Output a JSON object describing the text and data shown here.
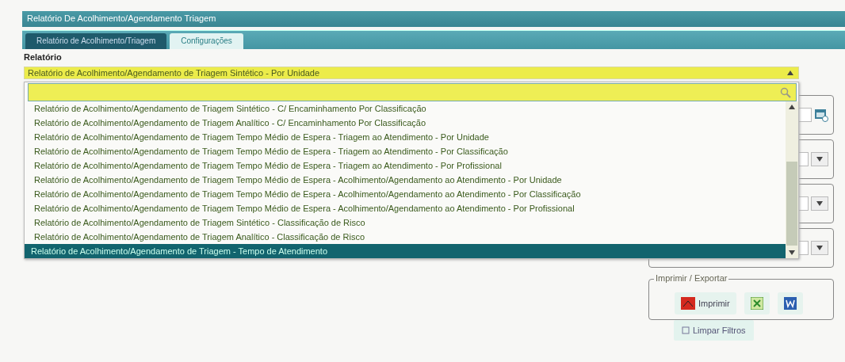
{
  "window": {
    "title": "Relatório De Acolhimento/Agendamento Triagem"
  },
  "tabs": [
    {
      "label": "Relatório de Acolhimento/Triagem",
      "selected": true
    },
    {
      "label": "Configurações",
      "selected": false
    }
  ],
  "report_field": {
    "label": "Relatório",
    "value": "Relatório de Acolhimento/Agendamento de Triagem Sintético - Por Unidade",
    "expanded": true
  },
  "options": [
    {
      "label": "Relatório de Acolhimento/Agendamento de Triagem Sintético - C/ Encaminhamento Por Classificação",
      "selected": false
    },
    {
      "label": "Relatório de Acolhimento/Agendamento de Triagem Analítico - C/ Encaminhamento Por Classificação",
      "selected": false
    },
    {
      "label": "Relatório de Acolhimento/Agendamento de Triagem Tempo Médio de Espera - Triagem ao Atendimento - Por Unidade",
      "selected": false
    },
    {
      "label": "Relatório de Acolhimento/Agendamento de Triagem Tempo Médio de Espera - Triagem ao Atendimento - Por Classificação",
      "selected": false
    },
    {
      "label": "Relatório de Acolhimento/Agendamento de Triagem Tempo Médio de Espera - Triagem ao Atendimento - Por Profissional",
      "selected": false
    },
    {
      "label": "Relatório de Acolhimento/Agendamento de Triagem Tempo Médio de Espera - Acolhimento/Agendamento ao Atendimento - Por Unidade",
      "selected": false
    },
    {
      "label": "Relatório de Acolhimento/Agendamento de Triagem Tempo Médio de Espera - Acolhimento/Agendamento ao Atendimento - Por Classificação",
      "selected": false
    },
    {
      "label": "Relatório de Acolhimento/Agendamento de Triagem Tempo Médio de Espera - Acolhimento/Agendamento ao Atendimento - Por Profissional",
      "selected": false
    },
    {
      "label": "Relatório de Acolhimento/Agendamento de Triagem Sintético - Classificação de Risco",
      "selected": false
    },
    {
      "label": "Relatório de Acolhimento/Agendamento de Triagem Analítico - Classificação de Risco",
      "selected": false
    },
    {
      "label": "Relatório de Acolhimento/Agendamento de Triagem - Tempo de Atendimento",
      "selected": true
    }
  ],
  "side_fields": [
    {
      "kind": "date"
    },
    {
      "kind": "select"
    },
    {
      "kind": "select"
    },
    {
      "kind": "select"
    }
  ],
  "export_group": {
    "legend": "Imprimir / Exportar",
    "buttons": [
      {
        "kind": "pdf",
        "label": "Imprimir"
      },
      {
        "kind": "excel"
      },
      {
        "kind": "word"
      }
    ]
  },
  "clear_button": {
    "label": "Limpar Filtros"
  }
}
